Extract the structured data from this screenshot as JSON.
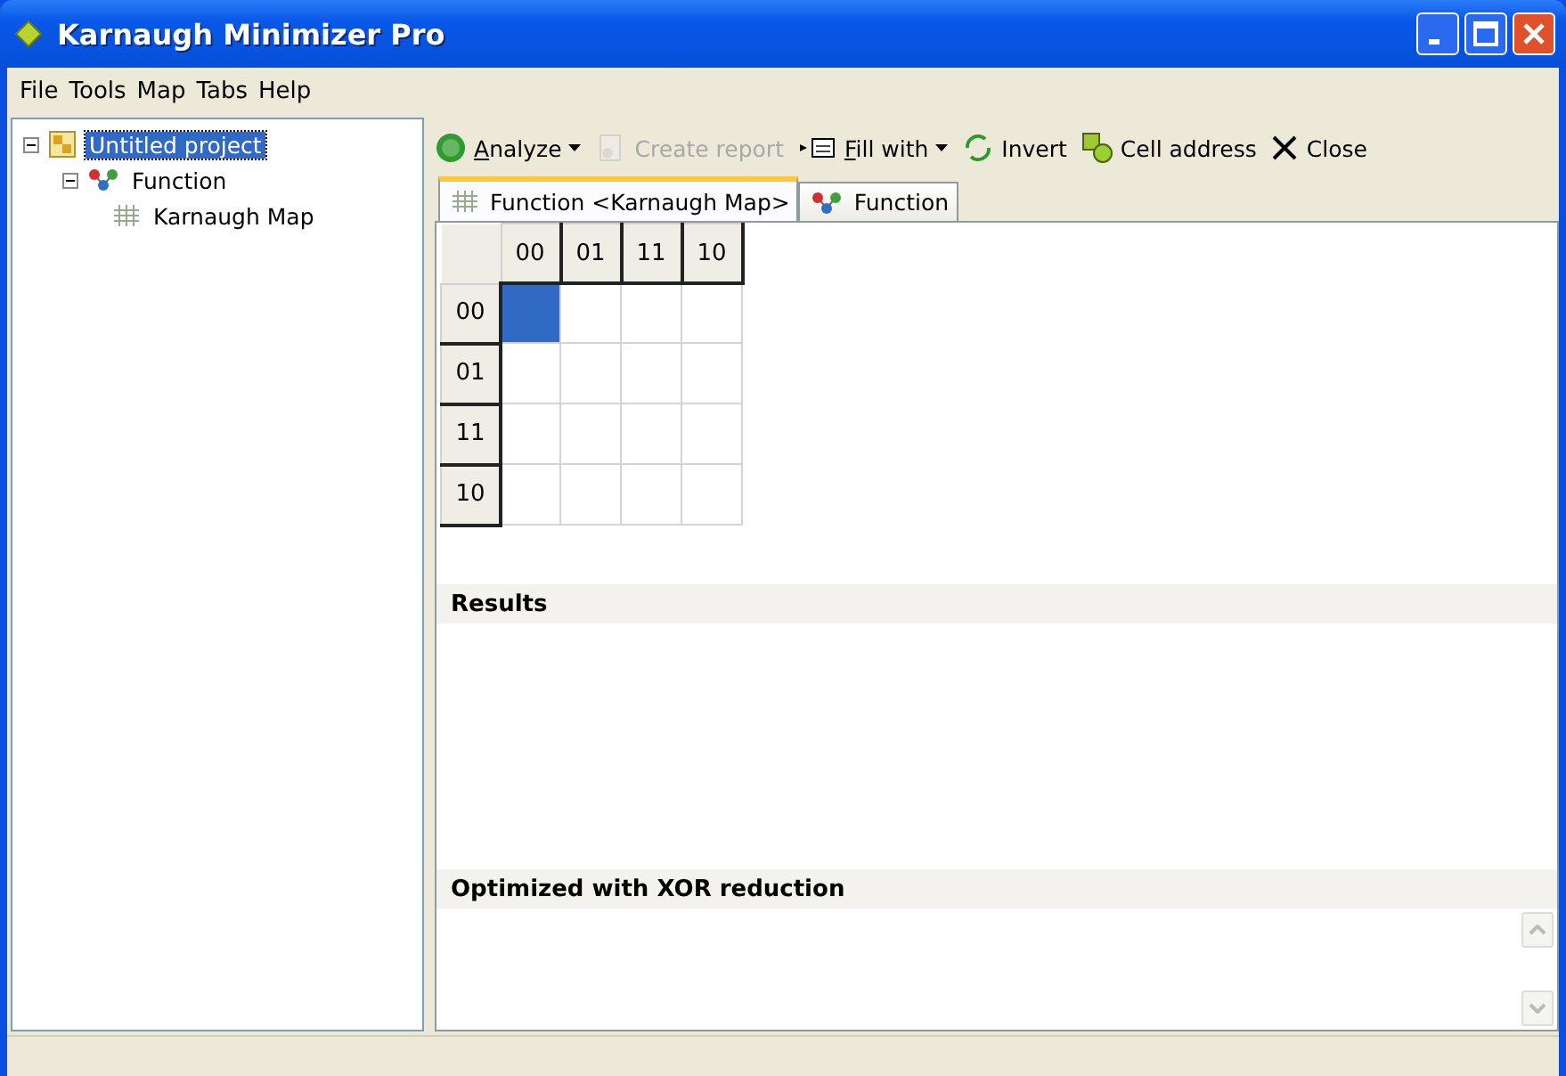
{
  "window": {
    "title": "Karnaugh Minimizer Pro"
  },
  "menu": [
    "File",
    "Tools",
    "Map",
    "Tabs",
    "Help"
  ],
  "tree": [
    {
      "label": "Untitled project",
      "kind": "project",
      "selected": true,
      "expanded": true,
      "children": [
        {
          "label": "Function",
          "kind": "function",
          "selected": false,
          "expanded": true,
          "children": [
            {
              "label": "Karnaugh Map",
              "kind": "map",
              "selected": false
            }
          ]
        }
      ]
    }
  ],
  "toolbar": [
    {
      "label": "Analyze",
      "kind": "go",
      "disabled": false,
      "dropdown": true,
      "mnemonic": true
    },
    {
      "label": "Create report",
      "kind": "report",
      "disabled": true,
      "dropdown": false,
      "mnemonic": false
    },
    {
      "label": "Fill with",
      "kind": "fill",
      "disabled": false,
      "dropdown": true,
      "mnemonic": true
    },
    {
      "label": "Invert",
      "kind": "invert",
      "disabled": false,
      "dropdown": false,
      "mnemonic": false
    },
    {
      "label": "Cell address",
      "kind": "address",
      "disabled": false,
      "dropdown": false,
      "mnemonic": false
    },
    {
      "label": "Close",
      "kind": "close",
      "disabled": false,
      "dropdown": false,
      "mnemonic": false
    }
  ],
  "tabs": [
    {
      "label": "Function <Karnaugh Map>",
      "kind": "map",
      "selected": true
    },
    {
      "label": "Function",
      "kind": "function",
      "selected": false
    }
  ],
  "kmap": {
    "columns": [
      "00",
      "01",
      "11",
      "10"
    ],
    "rows": [
      {
        "label": "00",
        "cells": [
          {
            "selected": true
          },
          {
            "selected": false
          },
          {
            "selected": false
          },
          {
            "selected": false
          }
        ]
      },
      {
        "label": "01",
        "cells": [
          {
            "selected": false
          },
          {
            "selected": false
          },
          {
            "selected": false
          },
          {
            "selected": false
          }
        ]
      },
      {
        "label": "11",
        "cells": [
          {
            "selected": false
          },
          {
            "selected": false
          },
          {
            "selected": false
          },
          {
            "selected": false
          }
        ]
      },
      {
        "label": "10",
        "cells": [
          {
            "selected": false
          },
          {
            "selected": false
          },
          {
            "selected": false
          },
          {
            "selected": false
          }
        ]
      }
    ]
  },
  "results": {
    "title": "Results"
  },
  "optimized": {
    "title": "Optimized with XOR reduction"
  }
}
